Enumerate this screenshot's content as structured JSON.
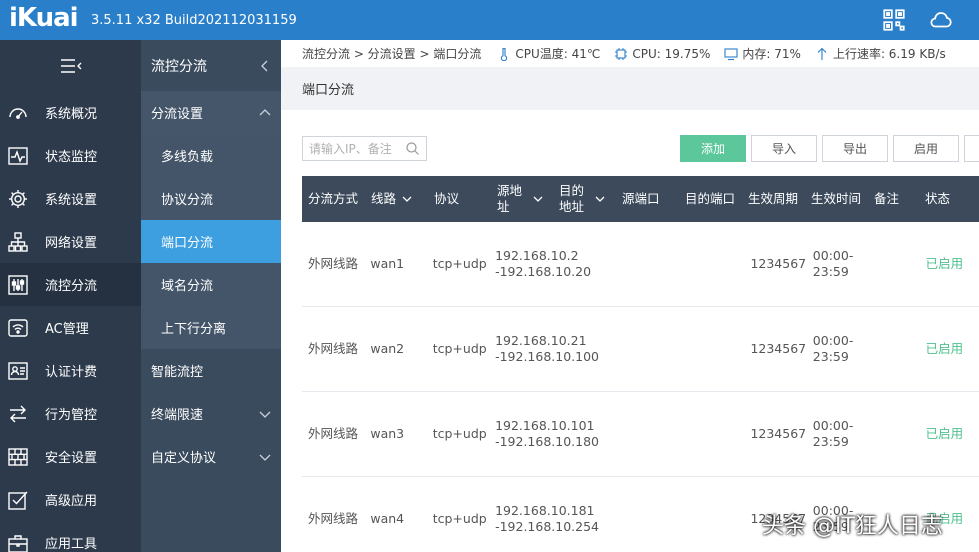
{
  "header": {
    "logo": "iKuai",
    "version": "3.5.11 x32 Build202112031159",
    "bg_color": "#2a7fca",
    "icons": [
      "qrcode-icon",
      "cloud-icon"
    ]
  },
  "sidebar": {
    "items": [
      {
        "label": "系统概况",
        "icon": "gauge-icon"
      },
      {
        "label": "状态监控",
        "icon": "pulse-icon"
      },
      {
        "label": "系统设置",
        "icon": "gear-icon"
      },
      {
        "label": "网络设置",
        "icon": "network-icon"
      },
      {
        "label": "流控分流",
        "icon": "sliders-icon",
        "active": true
      },
      {
        "label": "AC管理",
        "icon": "wifi-icon"
      },
      {
        "label": "认证计费",
        "icon": "id-card-icon"
      },
      {
        "label": "行为管控",
        "icon": "swap-icon"
      },
      {
        "label": "安全设置",
        "icon": "firewall-icon"
      },
      {
        "label": "高级应用",
        "icon": "check-box-icon"
      },
      {
        "label": "应用工具",
        "icon": "toolbox-icon"
      }
    ]
  },
  "subbar": {
    "title": "流控分流",
    "group_open": "分流设置",
    "children": [
      "多线负载",
      "协议分流",
      "端口分流",
      "域名分流",
      "上下行分离"
    ],
    "active_child": "端口分流",
    "groups_after": [
      {
        "label": "智能流控",
        "has_chevron": false
      },
      {
        "label": "终端限速",
        "has_chevron": true
      },
      {
        "label": "自定义协议",
        "has_chevron": true
      }
    ]
  },
  "statusbar": {
    "breadcrumb": "流控分流 > 分流设置 > 端口分流",
    "cpu_temp": "CPU温度: 41℃",
    "cpu": "CPU: 19.75%",
    "memory": "内存: 71%",
    "upload": "上行速率: 6.19 KB/s"
  },
  "page": {
    "title": "端口分流"
  },
  "toolbar": {
    "search_placeholder": "请输入IP、备注",
    "add": "添加",
    "import": "导入",
    "export": "导出",
    "enable": "启用",
    "accent": "#5bc79b"
  },
  "table": {
    "headers": [
      "分流方式",
      "线路",
      "协议",
      "源地址",
      "目的地址",
      "源端口",
      "目的端口",
      "生效周期",
      "生效时间",
      "备注",
      "状态"
    ],
    "rows": [
      {
        "mode": "外网线路",
        "line": "wan1",
        "proto": "tcp+udp",
        "src1": "192.168.10.2",
        "src2": "-192.168.10.20",
        "dst": "",
        "sport": "",
        "dport": "",
        "week": "1234567",
        "time1": "00:00-",
        "time2": "23:59",
        "note": "",
        "status": "已启用"
      },
      {
        "mode": "外网线路",
        "line": "wan2",
        "proto": "tcp+udp",
        "src1": "192.168.10.21",
        "src2": "-192.168.10.100",
        "dst": "",
        "sport": "",
        "dport": "",
        "week": "1234567",
        "time1": "00:00-",
        "time2": "23:59",
        "note": "",
        "status": "已启用"
      },
      {
        "mode": "外网线路",
        "line": "wan3",
        "proto": "tcp+udp",
        "src1": "192.168.10.101",
        "src2": "-192.168.10.180",
        "dst": "",
        "sport": "",
        "dport": "",
        "week": "1234567",
        "time1": "00:00-",
        "time2": "23:59",
        "note": "",
        "status": "已启用"
      },
      {
        "mode": "外网线路",
        "line": "wan4",
        "proto": "tcp+udp",
        "src1": "192.168.10.181",
        "src2": "-192.168.10.254",
        "dst": "",
        "sport": "",
        "dport": "",
        "week": "1234567",
        "time1": "00:00-",
        "time2": "23:59",
        "note": "",
        "status": "已启用"
      }
    ]
  },
  "watermark": "头条 @IT狂人日志"
}
